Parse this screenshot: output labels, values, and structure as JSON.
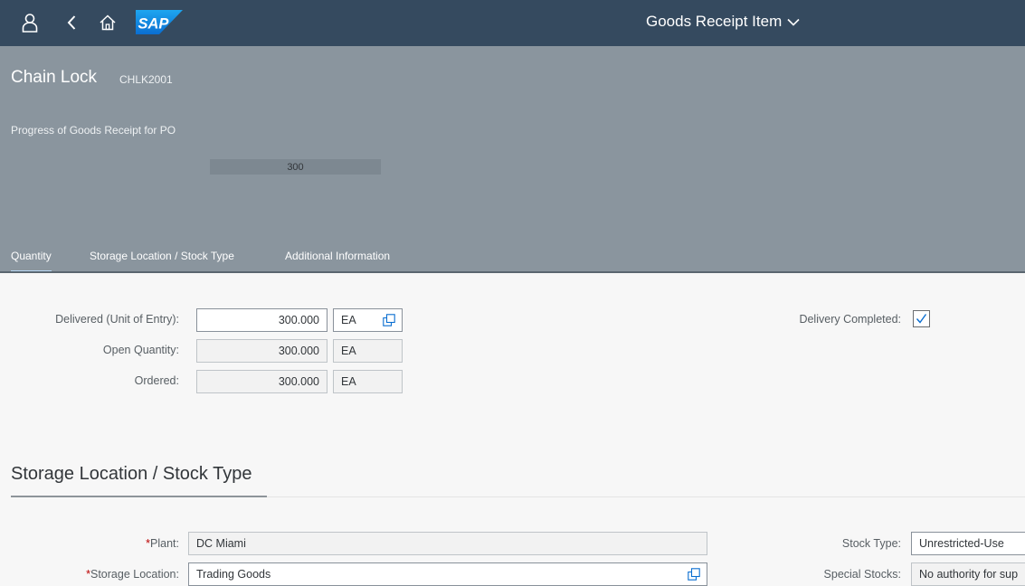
{
  "shell": {
    "title": "Goods Receipt Item",
    "logo_text": "SAP",
    "colors": {
      "bar": "#354a5f",
      "logo": "#0a6ed1"
    },
    "icons": [
      "user-icon",
      "back-icon",
      "home-icon",
      "chevron-down-icon"
    ]
  },
  "header": {
    "title": "Chain Lock",
    "subtitle": "CHLK2001",
    "progress_label": "Progress of Goods Receipt for PO",
    "progress_value": "300",
    "progress_fraction": 1.0,
    "tabs": [
      {
        "label": "Quantity",
        "selected": true
      },
      {
        "label": "Storage Location / Stock Type",
        "selected": false
      },
      {
        "label": "Additional Information",
        "selected": false
      }
    ]
  },
  "quantity": {
    "delivered": {
      "label": "Delivered (Unit of Entry):",
      "value": "300.000",
      "unit": "EA"
    },
    "open": {
      "label": "Open Quantity:",
      "value": "300.000",
      "unit": "EA"
    },
    "ordered": {
      "label": "Ordered:",
      "value": "300.000",
      "unit": "EA"
    },
    "delivery_completed": {
      "label": "Delivery Completed:",
      "checked": true
    }
  },
  "storage": {
    "section_title": "Storage Location / Stock Type",
    "required_mark": "*",
    "plant": {
      "label": "Plant:",
      "value": "DC Miami"
    },
    "storage_location": {
      "label": "Storage Location:",
      "value": "Trading Goods"
    },
    "stock_type": {
      "label": "Stock Type:",
      "value": "Unrestricted-Use"
    },
    "special_stocks": {
      "label": "Special Stocks:",
      "value": "No authority for sup"
    }
  }
}
